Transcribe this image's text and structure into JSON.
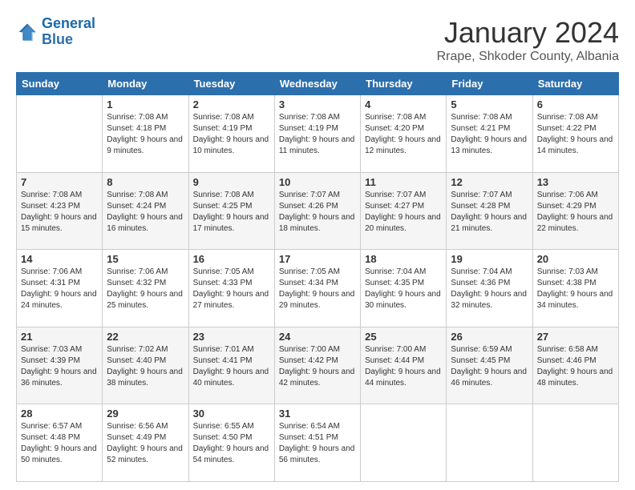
{
  "header": {
    "logo_general": "General",
    "logo_blue": "Blue",
    "month_title": "January 2024",
    "location": "Rrape, Shkoder County, Albania"
  },
  "days_of_week": [
    "Sunday",
    "Monday",
    "Tuesday",
    "Wednesday",
    "Thursday",
    "Friday",
    "Saturday"
  ],
  "weeks": [
    [
      {
        "day": "",
        "sunrise": "",
        "sunset": "",
        "daylight": ""
      },
      {
        "day": "1",
        "sunrise": "Sunrise: 7:08 AM",
        "sunset": "Sunset: 4:18 PM",
        "daylight": "Daylight: 9 hours and 9 minutes."
      },
      {
        "day": "2",
        "sunrise": "Sunrise: 7:08 AM",
        "sunset": "Sunset: 4:19 PM",
        "daylight": "Daylight: 9 hours and 10 minutes."
      },
      {
        "day": "3",
        "sunrise": "Sunrise: 7:08 AM",
        "sunset": "Sunset: 4:19 PM",
        "daylight": "Daylight: 9 hours and 11 minutes."
      },
      {
        "day": "4",
        "sunrise": "Sunrise: 7:08 AM",
        "sunset": "Sunset: 4:20 PM",
        "daylight": "Daylight: 9 hours and 12 minutes."
      },
      {
        "day": "5",
        "sunrise": "Sunrise: 7:08 AM",
        "sunset": "Sunset: 4:21 PM",
        "daylight": "Daylight: 9 hours and 13 minutes."
      },
      {
        "day": "6",
        "sunrise": "Sunrise: 7:08 AM",
        "sunset": "Sunset: 4:22 PM",
        "daylight": "Daylight: 9 hours and 14 minutes."
      }
    ],
    [
      {
        "day": "7",
        "sunrise": "Sunrise: 7:08 AM",
        "sunset": "Sunset: 4:23 PM",
        "daylight": "Daylight: 9 hours and 15 minutes."
      },
      {
        "day": "8",
        "sunrise": "Sunrise: 7:08 AM",
        "sunset": "Sunset: 4:24 PM",
        "daylight": "Daylight: 9 hours and 16 minutes."
      },
      {
        "day": "9",
        "sunrise": "Sunrise: 7:08 AM",
        "sunset": "Sunset: 4:25 PM",
        "daylight": "Daylight: 9 hours and 17 minutes."
      },
      {
        "day": "10",
        "sunrise": "Sunrise: 7:07 AM",
        "sunset": "Sunset: 4:26 PM",
        "daylight": "Daylight: 9 hours and 18 minutes."
      },
      {
        "day": "11",
        "sunrise": "Sunrise: 7:07 AM",
        "sunset": "Sunset: 4:27 PM",
        "daylight": "Daylight: 9 hours and 20 minutes."
      },
      {
        "day": "12",
        "sunrise": "Sunrise: 7:07 AM",
        "sunset": "Sunset: 4:28 PM",
        "daylight": "Daylight: 9 hours and 21 minutes."
      },
      {
        "day": "13",
        "sunrise": "Sunrise: 7:06 AM",
        "sunset": "Sunset: 4:29 PM",
        "daylight": "Daylight: 9 hours and 22 minutes."
      }
    ],
    [
      {
        "day": "14",
        "sunrise": "Sunrise: 7:06 AM",
        "sunset": "Sunset: 4:31 PM",
        "daylight": "Daylight: 9 hours and 24 minutes."
      },
      {
        "day": "15",
        "sunrise": "Sunrise: 7:06 AM",
        "sunset": "Sunset: 4:32 PM",
        "daylight": "Daylight: 9 hours and 25 minutes."
      },
      {
        "day": "16",
        "sunrise": "Sunrise: 7:05 AM",
        "sunset": "Sunset: 4:33 PM",
        "daylight": "Daylight: 9 hours and 27 minutes."
      },
      {
        "day": "17",
        "sunrise": "Sunrise: 7:05 AM",
        "sunset": "Sunset: 4:34 PM",
        "daylight": "Daylight: 9 hours and 29 minutes."
      },
      {
        "day": "18",
        "sunrise": "Sunrise: 7:04 AM",
        "sunset": "Sunset: 4:35 PM",
        "daylight": "Daylight: 9 hours and 30 minutes."
      },
      {
        "day": "19",
        "sunrise": "Sunrise: 7:04 AM",
        "sunset": "Sunset: 4:36 PM",
        "daylight": "Daylight: 9 hours and 32 minutes."
      },
      {
        "day": "20",
        "sunrise": "Sunrise: 7:03 AM",
        "sunset": "Sunset: 4:38 PM",
        "daylight": "Daylight: 9 hours and 34 minutes."
      }
    ],
    [
      {
        "day": "21",
        "sunrise": "Sunrise: 7:03 AM",
        "sunset": "Sunset: 4:39 PM",
        "daylight": "Daylight: 9 hours and 36 minutes."
      },
      {
        "day": "22",
        "sunrise": "Sunrise: 7:02 AM",
        "sunset": "Sunset: 4:40 PM",
        "daylight": "Daylight: 9 hours and 38 minutes."
      },
      {
        "day": "23",
        "sunrise": "Sunrise: 7:01 AM",
        "sunset": "Sunset: 4:41 PM",
        "daylight": "Daylight: 9 hours and 40 minutes."
      },
      {
        "day": "24",
        "sunrise": "Sunrise: 7:00 AM",
        "sunset": "Sunset: 4:42 PM",
        "daylight": "Daylight: 9 hours and 42 minutes."
      },
      {
        "day": "25",
        "sunrise": "Sunrise: 7:00 AM",
        "sunset": "Sunset: 4:44 PM",
        "daylight": "Daylight: 9 hours and 44 minutes."
      },
      {
        "day": "26",
        "sunrise": "Sunrise: 6:59 AM",
        "sunset": "Sunset: 4:45 PM",
        "daylight": "Daylight: 9 hours and 46 minutes."
      },
      {
        "day": "27",
        "sunrise": "Sunrise: 6:58 AM",
        "sunset": "Sunset: 4:46 PM",
        "daylight": "Daylight: 9 hours and 48 minutes."
      }
    ],
    [
      {
        "day": "28",
        "sunrise": "Sunrise: 6:57 AM",
        "sunset": "Sunset: 4:48 PM",
        "daylight": "Daylight: 9 hours and 50 minutes."
      },
      {
        "day": "29",
        "sunrise": "Sunrise: 6:56 AM",
        "sunset": "Sunset: 4:49 PM",
        "daylight": "Daylight: 9 hours and 52 minutes."
      },
      {
        "day": "30",
        "sunrise": "Sunrise: 6:55 AM",
        "sunset": "Sunset: 4:50 PM",
        "daylight": "Daylight: 9 hours and 54 minutes."
      },
      {
        "day": "31",
        "sunrise": "Sunrise: 6:54 AM",
        "sunset": "Sunset: 4:51 PM",
        "daylight": "Daylight: 9 hours and 56 minutes."
      },
      {
        "day": "",
        "sunrise": "",
        "sunset": "",
        "daylight": ""
      },
      {
        "day": "",
        "sunrise": "",
        "sunset": "",
        "daylight": ""
      },
      {
        "day": "",
        "sunrise": "",
        "sunset": "",
        "daylight": ""
      }
    ]
  ]
}
